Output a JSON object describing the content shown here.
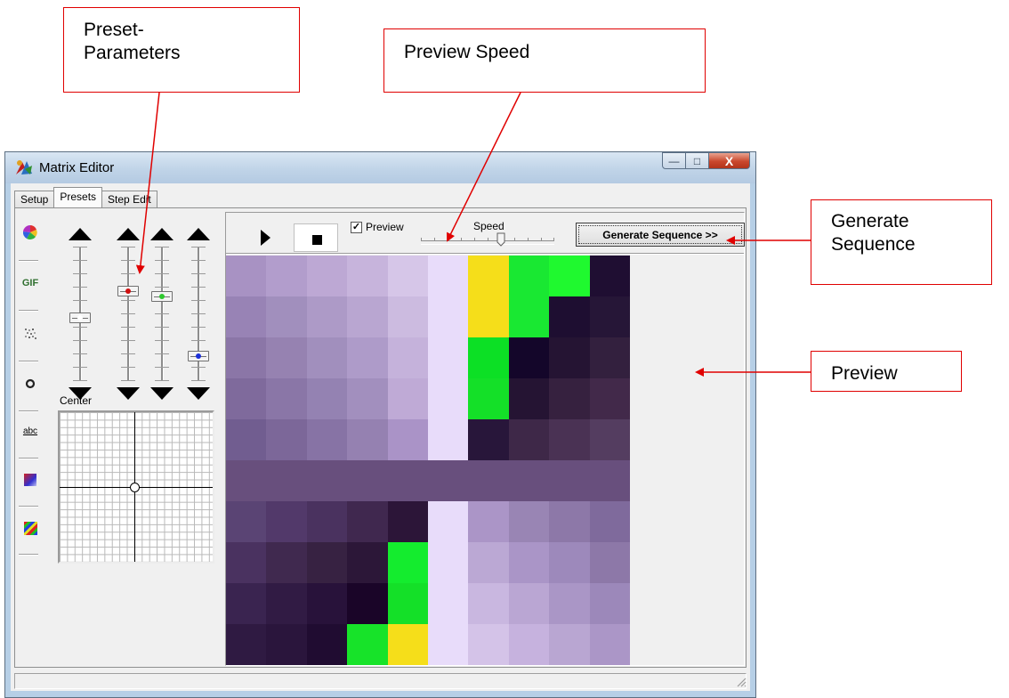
{
  "callouts": {
    "preset_parameters": "Preset-\nParameters",
    "preview_speed": "Preview Speed",
    "generate_sequence": "Generate\nSequence",
    "preview": "Preview"
  },
  "window": {
    "title": "Matrix Editor",
    "close_glyph": "X",
    "max_glyph": "□",
    "min_glyph": "—"
  },
  "tabs": [
    {
      "label": "Setup",
      "active": false
    },
    {
      "label": "Presets",
      "active": true
    },
    {
      "label": "Step Edit",
      "active": false
    }
  ],
  "left_toolbar": [
    {
      "icon": "color-wheel-icon"
    },
    {
      "icon": "gif-icon",
      "label": "GIF"
    },
    {
      "icon": "noise-icon"
    },
    {
      "icon": "ring-icon"
    },
    {
      "icon": "text-scroll-icon",
      "label": "abc"
    },
    {
      "icon": "gradient-icon"
    },
    {
      "icon": "rainbow-stripes-icon"
    }
  ],
  "sliders": [
    {
      "name": "slider-1",
      "level": 0.53,
      "color": "#ffffff"
    },
    {
      "name": "slider-2",
      "level": 0.33,
      "color": "#d01010"
    },
    {
      "name": "slider-3",
      "level": 0.37,
      "color": "#2ec82e"
    },
    {
      "name": "slider-4",
      "level": 0.82,
      "color": "#1b2fd8"
    }
  ],
  "center_label": "Center",
  "toolbar": {
    "play_icon": "play-icon",
    "stop_icon": "stop-icon",
    "preview_label": "Preview",
    "preview_checked": true,
    "speed_label": "Speed",
    "speed_level": 0.6,
    "generate_label": "Generate Sequence >>"
  },
  "matrix": [
    [
      "#a892c3",
      "#b29dcc",
      "#bda8d4",
      "#c7b4dc",
      "#d6c6e8",
      "#e8dcfa",
      "#f5de1a",
      "#19e832",
      "#1ff92f",
      "#1f0e32"
    ],
    [
      "#9883b5",
      "#a18fbd",
      "#ad9ac7",
      "#b9a6d1",
      "#ccbbe0",
      "#e8dcfa",
      "#f5de1a",
      "#19e832",
      "#1e0e31",
      "#261637"
    ],
    [
      "#8b76a7",
      "#9682b1",
      "#a18fbd",
      "#ae9bc9",
      "#c5b2db",
      "#e8dcfa",
      "#0ce025",
      "#14062a",
      "#251433",
      "#33203e"
    ],
    [
      "#7f6a9c",
      "#8a76a7",
      "#9482b2",
      "#a28fbe",
      "#bfaad6",
      "#e8dcfa",
      "#14e028",
      "#251433",
      "#36213f",
      "#42294a"
    ],
    [
      "#715d90",
      "#7c6799",
      "#8773a5",
      "#9581b1",
      "#aa93c7",
      "#e8dcfa",
      "#28163a",
      "#3e2848",
      "#4a3254",
      "#543d60"
    ],
    [
      "#684f7d",
      "#684f7d",
      "#684f7d",
      "#684f7d",
      "#684f7d",
      "#684f7d",
      "#684f7d",
      "#684f7d",
      "#684f7d",
      "#684f7d"
    ],
    [
      "#5a4474",
      "#52396a",
      "#4a325f",
      "#40284f",
      "#2c1538",
      "#e8dcfa",
      "#ab95c7",
      "#9985b4",
      "#8d78a8",
      "#7f6a9c"
    ],
    [
      "#4a3260",
      "#40294f",
      "#372242",
      "#2c1738",
      "#14ec2e",
      "#e8dcfa",
      "#bba8d4",
      "#aa95c7",
      "#9d89bb",
      "#8d78a8"
    ],
    [
      "#3a2450",
      "#311b44",
      "#28123a",
      "#1a0528",
      "#14e028",
      "#e8dcfa",
      "#c9b7e0",
      "#baa6d3",
      "#aa96c6",
      "#9c88ba"
    ],
    [
      "#2f1a42",
      "#2a153c",
      "#200c31",
      "#17e329",
      "#f5de1a",
      "#e8dcfa",
      "#d4c3e8",
      "#c6b2de",
      "#b9a6d2",
      "#ab96c7"
    ]
  ]
}
